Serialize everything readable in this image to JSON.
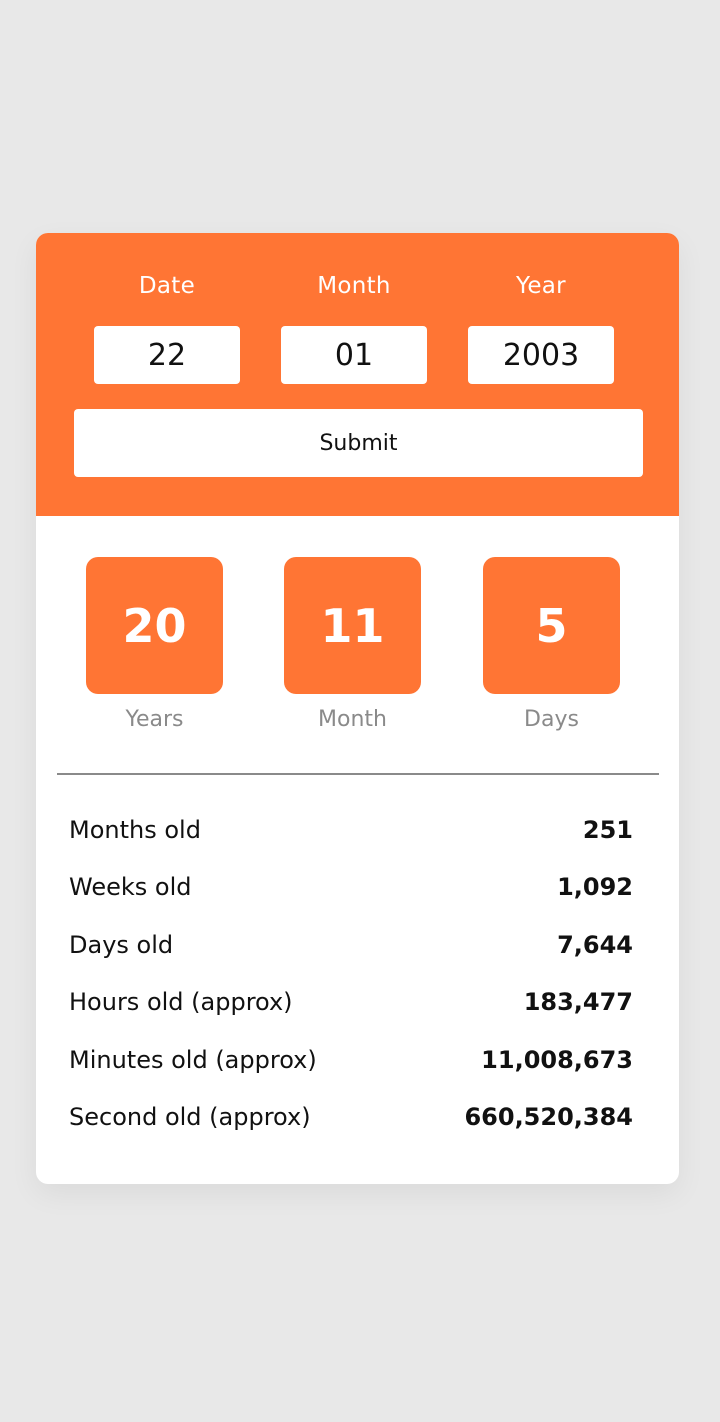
{
  "colors": {
    "accent": "#ff7534",
    "background": "#e8e8e8",
    "card": "#ffffff",
    "muted_text": "#8a8a8a"
  },
  "form": {
    "date_label": "Date",
    "month_label": "Month",
    "year_label": "Year",
    "date_value": "22",
    "month_value": "01",
    "year_value": "2003",
    "submit_label": "Submit"
  },
  "result": {
    "years_value": "20",
    "years_label": "Years",
    "months_value": "11",
    "months_label": "Month",
    "days_value": "5",
    "days_label": "Days"
  },
  "stats": [
    {
      "label": "Months old",
      "value": "251"
    },
    {
      "label": "Weeks old",
      "value": "1,092"
    },
    {
      "label": "Days old",
      "value": "7,644"
    },
    {
      "label": "Hours old (approx)",
      "value": "183,477"
    },
    {
      "label": "Minutes old (approx)",
      "value": "11,008,673"
    },
    {
      "label": "Second old (approx)",
      "value": "660,520,384"
    }
  ]
}
